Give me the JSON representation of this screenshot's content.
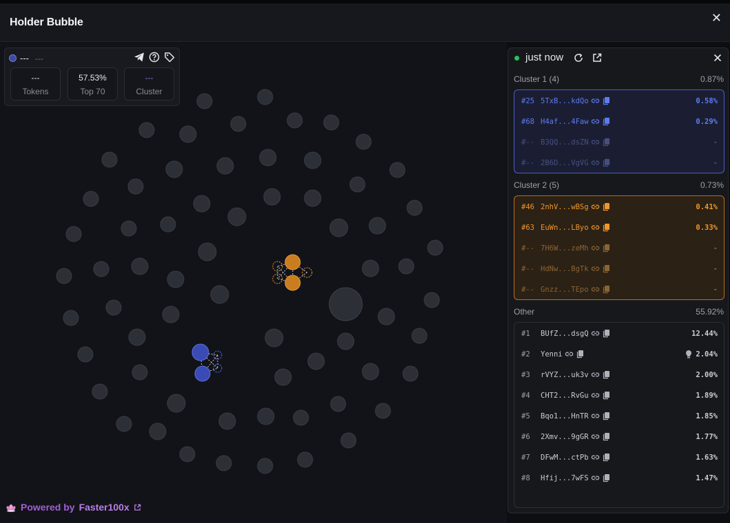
{
  "window": {
    "title": "Holder Bubble",
    "close_glyph": "✕"
  },
  "info_card": {
    "name": "---",
    "sub": "---",
    "icons": [
      "telegram-icon",
      "help-icon",
      "tag-icon"
    ],
    "stats": [
      {
        "value": "---",
        "label": "Tokens"
      },
      {
        "value": "57.53%",
        "label": "Top 70"
      },
      {
        "value": "---",
        "label": "Cluster"
      }
    ]
  },
  "powered": {
    "prefix": "Powered by",
    "brand": "Faster100x",
    "logo": "lotus-icon"
  },
  "panel": {
    "status": "just now",
    "icons": [
      "refresh-icon",
      "external-link-icon",
      "close-icon"
    ],
    "clusters": [
      {
        "title": "Cluster 1 (4)",
        "total": "0.87%",
        "color": "#4f6bdc",
        "rows": [
          {
            "rank": "#25",
            "address": "5TxB...kdQo",
            "percent": "0.58%",
            "active": true
          },
          {
            "rank": "#68",
            "address": "H4af...4Faw",
            "percent": "0.29%",
            "active": true
          },
          {
            "rank": "#--",
            "address": "B3QQ...dsZN",
            "percent": "-",
            "active": false
          },
          {
            "rank": "#--",
            "address": "2B6D...VgVG",
            "percent": "-",
            "active": false
          }
        ]
      },
      {
        "title": "Cluster 2 (5)",
        "total": "0.73%",
        "color": "#e58f1c",
        "rows": [
          {
            "rank": "#46",
            "address": "2nhV...wBSg",
            "percent": "0.41%",
            "active": true
          },
          {
            "rank": "#63",
            "address": "EuWn...LByo",
            "percent": "0.33%",
            "active": true
          },
          {
            "rank": "#--",
            "address": "7H6W...zeMh",
            "percent": "-",
            "active": false
          },
          {
            "rank": "#--",
            "address": "HdNw...BgTk",
            "percent": "-",
            "active": false
          },
          {
            "rank": "#--",
            "address": "Gnzz...TEpo",
            "percent": "-",
            "active": false
          }
        ]
      }
    ],
    "other": {
      "title": "Other",
      "total": "55.92%",
      "rows": [
        {
          "rank": "#1",
          "address": "BUfZ...dsgQ",
          "percent": "12.44%",
          "link": true
        },
        {
          "rank": "#2",
          "address": "Yenni",
          "percent": "2.04%",
          "link": true,
          "bulb": true
        },
        {
          "rank": "#3",
          "address": "rVYZ...uk3v",
          "percent": "2.00%",
          "link": true
        },
        {
          "rank": "#4",
          "address": "CHT2...RvGu",
          "percent": "1.89%",
          "link": true
        },
        {
          "rank": "#5",
          "address": "Bqo1...HnTR",
          "percent": "1.85%",
          "link": true
        },
        {
          "rank": "#6",
          "address": "2Xmv...9gGR",
          "percent": "1.77%",
          "link": true
        },
        {
          "rank": "#7",
          "address": "DFwM...ctPb",
          "percent": "1.63%",
          "link": true
        },
        {
          "rank": "#8",
          "address": "Hfij...7wFS",
          "percent": "1.47%",
          "link": true
        }
      ]
    }
  }
}
